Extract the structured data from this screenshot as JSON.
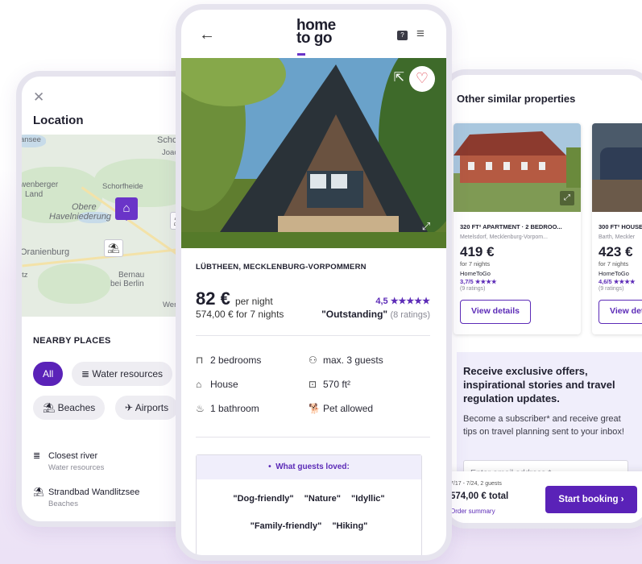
{
  "location_screen": {
    "title": "Location",
    "map_labels": [
      "ansee",
      "Scho",
      "Joac",
      "wenberger",
      "Land",
      "Schorfheide",
      "Obere",
      "Havelniederung",
      "Oranienburg",
      "Bernau",
      "bei Berlin",
      "itz",
      "Wer"
    ],
    "nearby_title": "NEARBY PLACES",
    "chips": [
      {
        "label": "All",
        "icon": ""
      },
      {
        "label": "Water resources",
        "icon": "≣"
      },
      {
        "label": "Beaches",
        "icon": "⛱"
      },
      {
        "label": "Airports",
        "icon": "✈"
      }
    ],
    "places": [
      {
        "name": "Closest river",
        "category": "Water resources",
        "icon": "≣"
      },
      {
        "name": "Strandbad Wandlitzsee",
        "category": "Beaches",
        "icon": "⛱"
      }
    ]
  },
  "detail_screen": {
    "logo_line1": "home",
    "logo_line2": "to go",
    "region": "LÜBTHEEN, MECKLENBURG-VORPOMMERN",
    "price": "82 €",
    "price_unit": "per night",
    "total": "574,00 € for 7 nights",
    "rating": "4,5 ★★★★★",
    "rating_word": "\"Outstanding\"",
    "rating_count": "(8 ratings)",
    "features": [
      {
        "label": "2 bedrooms",
        "icon": "⊓"
      },
      {
        "label": "max. 3 guests",
        "icon": "⚇"
      },
      {
        "label": "House",
        "icon": "⌂"
      },
      {
        "label": "570 ft²",
        "icon": "⊡"
      },
      {
        "label": "1 bathroom",
        "icon": "♨"
      },
      {
        "label": "Pet allowed",
        "icon": "🐕"
      }
    ],
    "loved_title": "What guests loved:",
    "loved_tags_row1": [
      "\"Dog-friendly\"",
      "\"Nature\"",
      "\"Idyllic\""
    ],
    "loved_tags_row2": [
      "\"Family-friendly\"",
      "\"Hiking\""
    ]
  },
  "similar_screen": {
    "title": "Other similar properties",
    "cards": [
      {
        "kind": "320 FT² APARTMENT · 2 BEDROO...",
        "place": "Metelsdorf, Mecklenburg-Vorpom...",
        "price": "419 €",
        "nights": "for 7 nights",
        "provider": "HomeToGo",
        "rating": "3,7/5 ★★★★",
        "count": "(9 ratings)",
        "button": "View details"
      },
      {
        "kind": "300 FT² HOUSE",
        "place": "Barth, Meckler",
        "price": "423 €",
        "nights": "for 7 nights",
        "provider": "HomeToGo",
        "rating": "4,6/5 ★★★★",
        "count": "(9 ratings)",
        "button": "View details"
      }
    ],
    "newsletter_title": "Receive exclusive offers, inspirational stories and travel regulation updates.",
    "newsletter_text": "Become a subscriber* and receive great tips on travel planning sent to your inbox!",
    "email_placeholder": "Enter email address *",
    "booking_dates": "7/17 - 7/24, 2 guests",
    "booking_total": "574,00 € total",
    "order_summary": "Order summary",
    "booking_button": "Start booking"
  },
  "colors": {
    "accent": "#5a22b8",
    "heart": "#e2545f"
  }
}
